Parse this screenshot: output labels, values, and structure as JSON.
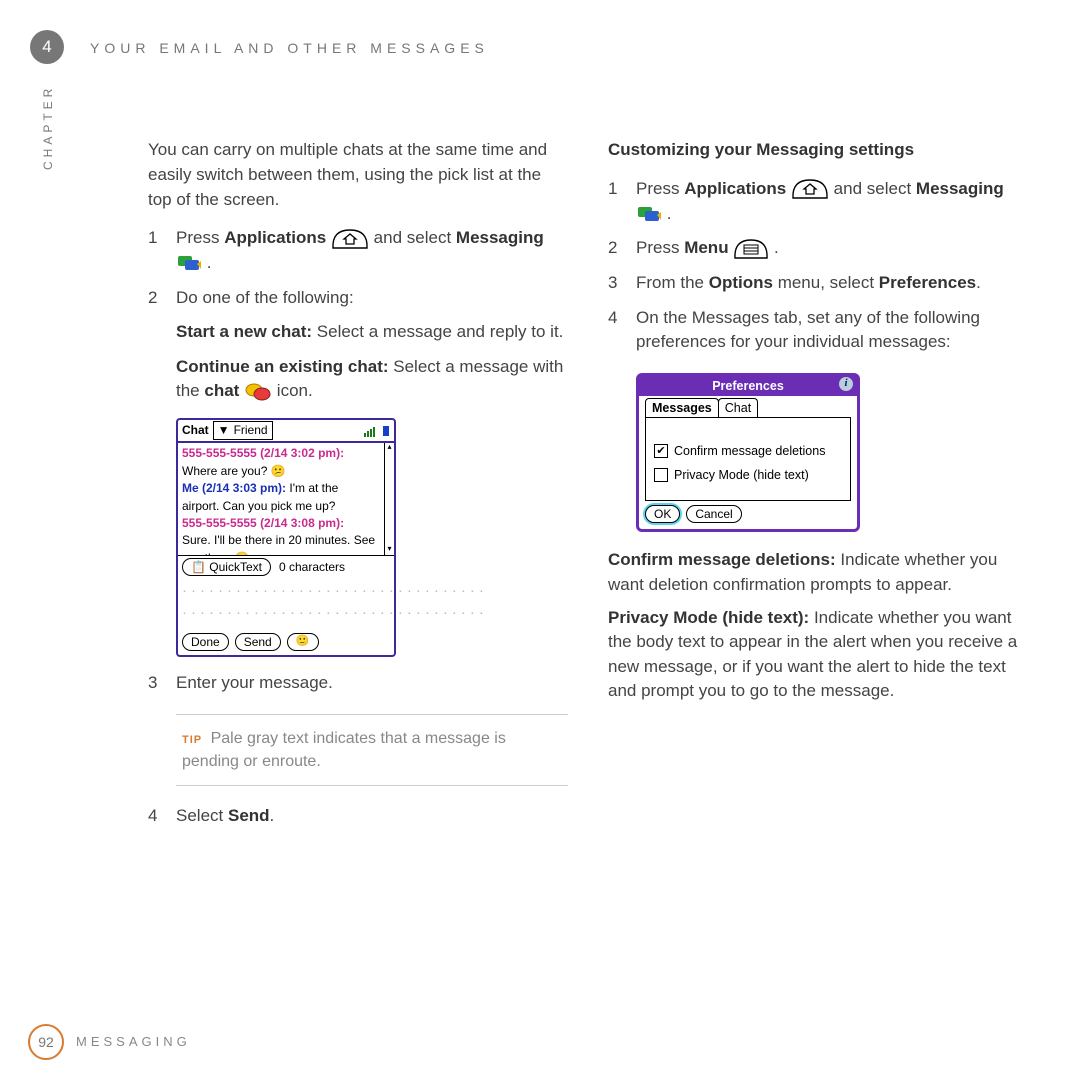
{
  "chapter": {
    "number": "4",
    "title": "YOUR EMAIL AND OTHER MESSAGES",
    "side_label": "CHAPTER"
  },
  "footer": {
    "page": "92",
    "section": "MESSAGING"
  },
  "left": {
    "intro": "You can carry on multiple chats at the same time and easily switch between them, using the pick list at the top of the screen.",
    "steps": {
      "1a": "Press ",
      "1b": "Applications",
      "1c": " and select ",
      "1d": "Messaging",
      "1e": " .",
      "2": "Do one of the following:",
      "2a_bold": "Start a new chat:",
      "2a_rest": " Select a message and reply to it.",
      "2b_bold": "Continue an existing chat:",
      "2b_rest1": " Select a message with the ",
      "2b_rest2": "chat",
      "2b_rest3": " icon.",
      "3": "Enter your message.",
      "4a": "Select ",
      "4b": "Send",
      "4c": "."
    },
    "tip": {
      "label": "TIP",
      "text": "Pale gray text indicates that a message is pending or enroute."
    }
  },
  "chat_screenshot": {
    "header_label": "Chat",
    "dropdown": "▼",
    "friend": "Friend",
    "lines": {
      "l1": "555-555-5555 (2/14 3:02 pm):",
      "l2a": "Where are you? ",
      "l3a": "Me (2/14 3:03 pm):",
      "l3b": " I'm at the",
      "l4": "airport.  Can you pick me up?",
      "l5": "555-555-5555 (2/14 3:08 pm):",
      "l6": "Sure.  I'll be there in 20 minutes.  See",
      "l7": "you then. "
    },
    "quicktext": "QuickText",
    "charcount": "0 characters",
    "input_placeholder": "····················\n····················",
    "done": "Done",
    "send": "Send"
  },
  "right": {
    "heading": "Customizing your Messaging settings",
    "steps": {
      "1a": "Press ",
      "1b": "Applications",
      "1c": " and select ",
      "1d": "Messaging",
      "1e": " .",
      "2a": "Press ",
      "2b": "Menu",
      "2c": " .",
      "3a": "From the ",
      "3b": "Options",
      "3c": " menu, select ",
      "3d": "Preferences",
      "3e": ".",
      "4": "On the Messages tab, set any of the following preferences for your individual messages:"
    },
    "defs": {
      "d1_bold": "Confirm message deletions:",
      "d1_rest": " Indicate whether you want deletion confirmation prompts to appear.",
      "d2_bold": "Privacy Mode (hide text):",
      "d2_rest": " Indicate whether you want the body text to appear in the alert when you receive a new message, or if you want the alert to hide the text and prompt you to go to the message."
    }
  },
  "prefs_screenshot": {
    "title": "Preferences",
    "tab_messages": "Messages",
    "tab_chat": "Chat",
    "opt1": "Confirm message deletions",
    "opt1_checked": "✔",
    "opt2": "Privacy Mode (hide text)",
    "ok": "OK",
    "cancel": "Cancel"
  }
}
